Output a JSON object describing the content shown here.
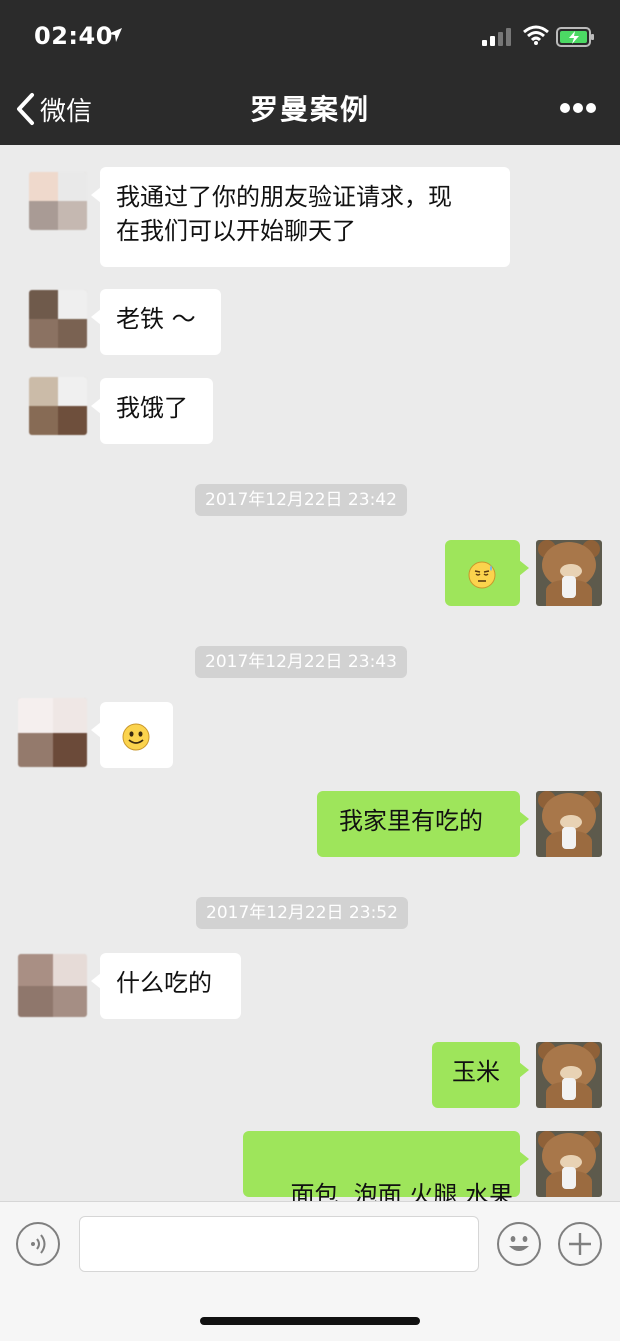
{
  "status_bar": {
    "time": "02:40"
  },
  "nav": {
    "back_label": "微信",
    "title": "罗曼案例"
  },
  "messages": [
    {
      "side": "left",
      "text": "我通过了你的朋友验证请求，现在我们可以开始聊天了"
    },
    {
      "side": "left",
      "text": "老铁 ～"
    },
    {
      "side": "left",
      "text": "我饿了"
    },
    {
      "type": "timestamp",
      "text": "2017年12月22日 23:42"
    },
    {
      "side": "right",
      "emoji": "sweat-emoji"
    },
    {
      "type": "timestamp",
      "text": "2017年12月22日 23:43"
    },
    {
      "side": "left",
      "emoji": "smile-emoji"
    },
    {
      "side": "right",
      "text": "我家里有吃的"
    },
    {
      "type": "timestamp",
      "text": "2017年12月22日 23:52"
    },
    {
      "side": "left",
      "text": "什么吃的"
    },
    {
      "side": "right",
      "text": "玉米"
    },
    {
      "side": "right",
      "text": "面包  泡面 火腿 水果"
    }
  ],
  "timestamps": [
    "2017年12月22日 23:42",
    "2017年12月22日 23:43",
    "2017年12月22日 23:52"
  ],
  "texts": {
    "m1_line1": "我通过了你的朋友验证请求，现",
    "m1_line2": "在我们可以开始聊天了",
    "m2": "老铁 ～",
    "m3": "我饿了",
    "m7": "我家里有吃的",
    "m9": "什么吃的",
    "m10": "玉米",
    "m11": "面包  泡面 火腿 水果"
  },
  "input": {
    "value": "",
    "placeholder": ""
  },
  "colors": {
    "nav_bg": "#2b2b2b",
    "chat_bg": "#ebebeb",
    "sent_bubble": "#9ee55b",
    "received_bubble": "#ffffff"
  }
}
